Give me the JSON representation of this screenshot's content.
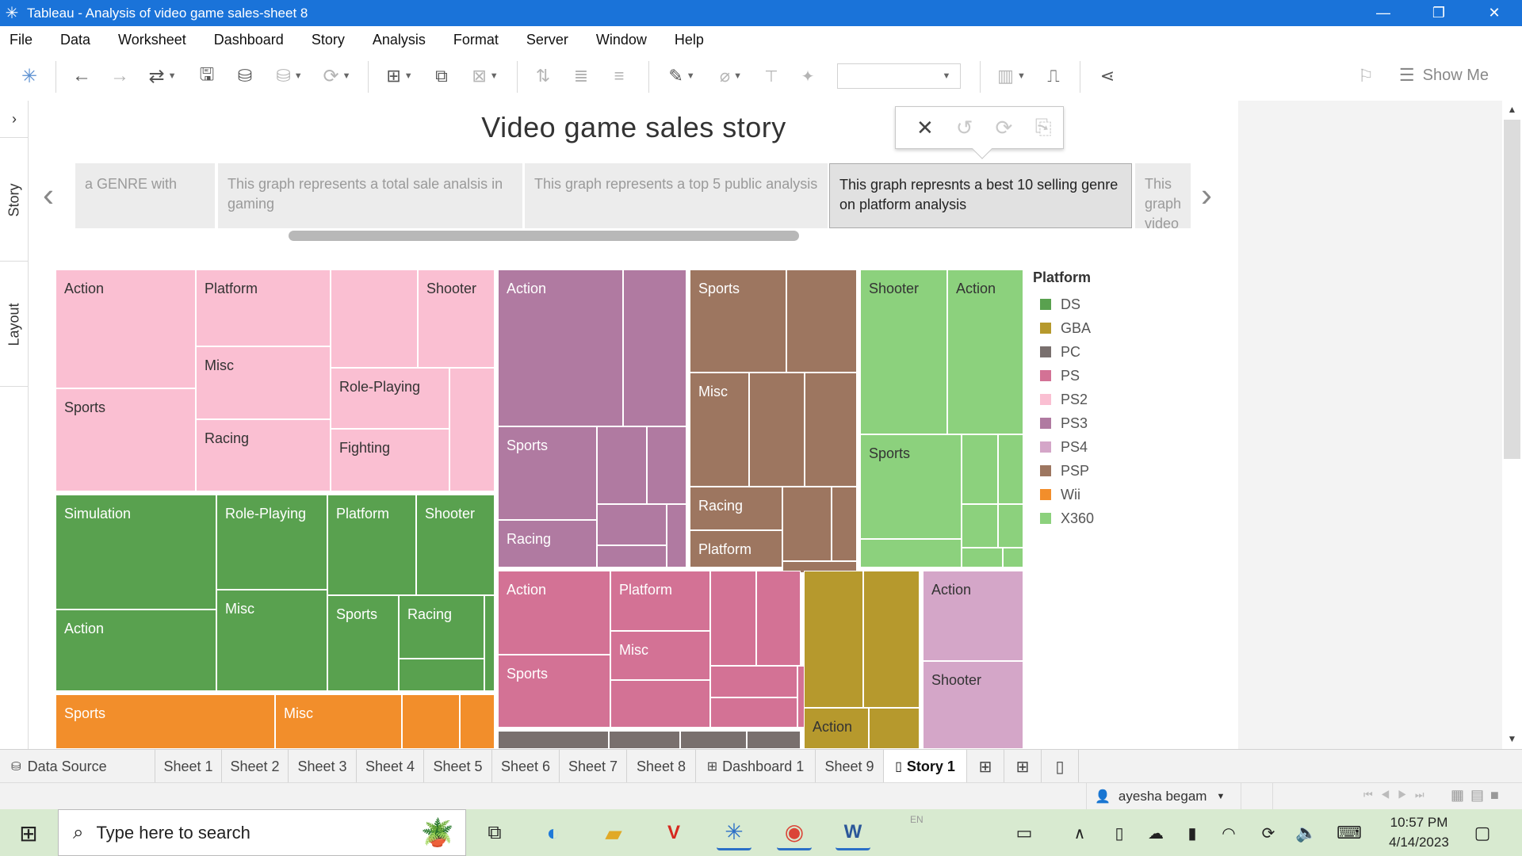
{
  "window": {
    "title": "Tableau - Analysis of video game sales-sheet 8",
    "controls": [
      "—",
      "❐",
      "✕"
    ]
  },
  "menu": [
    "File",
    "Data",
    "Worksheet",
    "Dashboard",
    "Story",
    "Analysis",
    "Format",
    "Server",
    "Window",
    "Help"
  ],
  "toolbar": {
    "show_me_label": "Show Me"
  },
  "side_tabs": {
    "story": "Story",
    "layout": "Layout"
  },
  "story": {
    "title": "Video game sales story",
    "points": [
      {
        "text": "a  GENRE  with",
        "active": false
      },
      {
        "text": "This graph represents a total sale analsis in gaming",
        "active": false
      },
      {
        "text": "This graph  represents a top 5 public analysis",
        "active": false
      },
      {
        "text": "This  graph represnts a  best 10 selling genre on platform  analysis",
        "active": true
      },
      {
        "text": "This graph video g",
        "active": false
      }
    ]
  },
  "legend": {
    "title": "Platform",
    "items": [
      {
        "name": "DS",
        "color": "#59a14f"
      },
      {
        "name": "GBA",
        "color": "#b6992d"
      },
      {
        "name": "PC",
        "color": "#79706e"
      },
      {
        "name": "PS",
        "color": "#d37295"
      },
      {
        "name": "PS2",
        "color": "#fabfd2"
      },
      {
        "name": "PS3",
        "color": "#b07aa1"
      },
      {
        "name": "PS4",
        "color": "#d4a6c8"
      },
      {
        "name": "PSP",
        "color": "#9d7660"
      },
      {
        "name": "Wii",
        "color": "#f28e2b"
      },
      {
        "name": "X360",
        "color": "#8cd17d"
      }
    ]
  },
  "chart_data": {
    "type": "treemap",
    "title": "",
    "color_by": "Platform",
    "labels_shown": [
      {
        "platform": "PS2",
        "genres": [
          "Action",
          "Sports",
          "Platform",
          "Misc",
          "Racing",
          "Shooter",
          "Role-Playing",
          "Fighting"
        ]
      },
      {
        "platform": "PS3",
        "genres": [
          "Action",
          "Sports",
          "Racing"
        ]
      },
      {
        "platform": "PSP",
        "genres": [
          "Sports",
          "Misc",
          "Racing",
          "Platform"
        ]
      },
      {
        "platform": "X360",
        "genres": [
          "Shooter",
          "Action",
          "Sports"
        ]
      },
      {
        "platform": "DS",
        "genres": [
          "Simulation",
          "Action",
          "Role-Playing",
          "Misc",
          "Platform",
          "Sports",
          "Shooter",
          "Racing"
        ]
      },
      {
        "platform": "Wii",
        "genres": [
          "Sports",
          "Misc"
        ]
      },
      {
        "platform": "PS",
        "genres": [
          "Action",
          "Sports",
          "Platform",
          "Misc"
        ]
      },
      {
        "platform": "GBA",
        "genres": [
          "Action"
        ]
      },
      {
        "platform": "PS4",
        "genres": [
          "Action",
          "Shooter"
        ]
      },
      {
        "platform": "PC",
        "genres": []
      }
    ]
  },
  "sheet_tabs": [
    "Data Source",
    "Sheet 1",
    "Sheet 2",
    "Sheet 3",
    "Sheet 4",
    "Sheet 5",
    "Sheet 6",
    "Sheet 7",
    "Sheet 8",
    "Dashboard 1",
    "Sheet 9",
    "Story 1"
  ],
  "status": {
    "user": "ayesha begam"
  },
  "taskbar": {
    "search_placeholder": "Type here to search",
    "lang": "EN",
    "time": "10:57 PM",
    "date": "4/14/2023"
  }
}
